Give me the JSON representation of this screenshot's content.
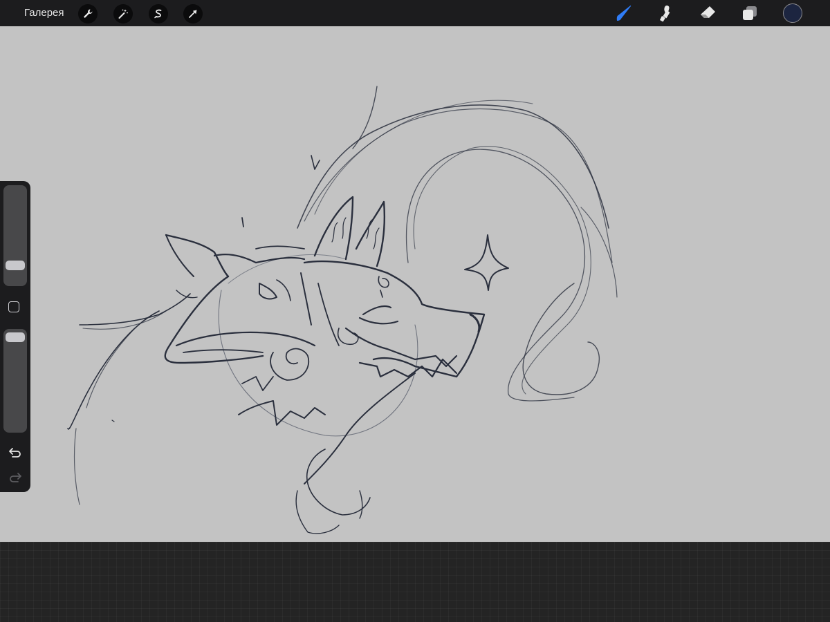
{
  "topbar": {
    "gallery_label": "Галерея",
    "left_tools": [
      {
        "name": "wrench-icon",
        "label": "actions"
      },
      {
        "name": "magic-wand-icon",
        "label": "adjustments"
      },
      {
        "name": "selection-icon",
        "label": "selection"
      },
      {
        "name": "transform-arrow-icon",
        "label": "transform"
      }
    ],
    "right_tools": [
      {
        "name": "brush-icon",
        "label": "paint",
        "active": true
      },
      {
        "name": "smudge-icon",
        "label": "smudge",
        "active": false
      },
      {
        "name": "eraser-icon",
        "label": "eraser",
        "active": false
      },
      {
        "name": "layers-icon",
        "label": "layers",
        "active": false
      }
    ],
    "active_color": "#1c2540",
    "accent_color": "#2f7cf6"
  },
  "sidebar": {
    "brush_size_level": 0.28,
    "opacity_level": 0.95,
    "icons": [
      "modify-square-icon",
      "undo-icon",
      "redo-icon"
    ]
  },
  "canvas": {
    "background_color": "#c3c3c3",
    "stroke_color": "#2a2f3d",
    "content": "sketch-drawing"
  }
}
